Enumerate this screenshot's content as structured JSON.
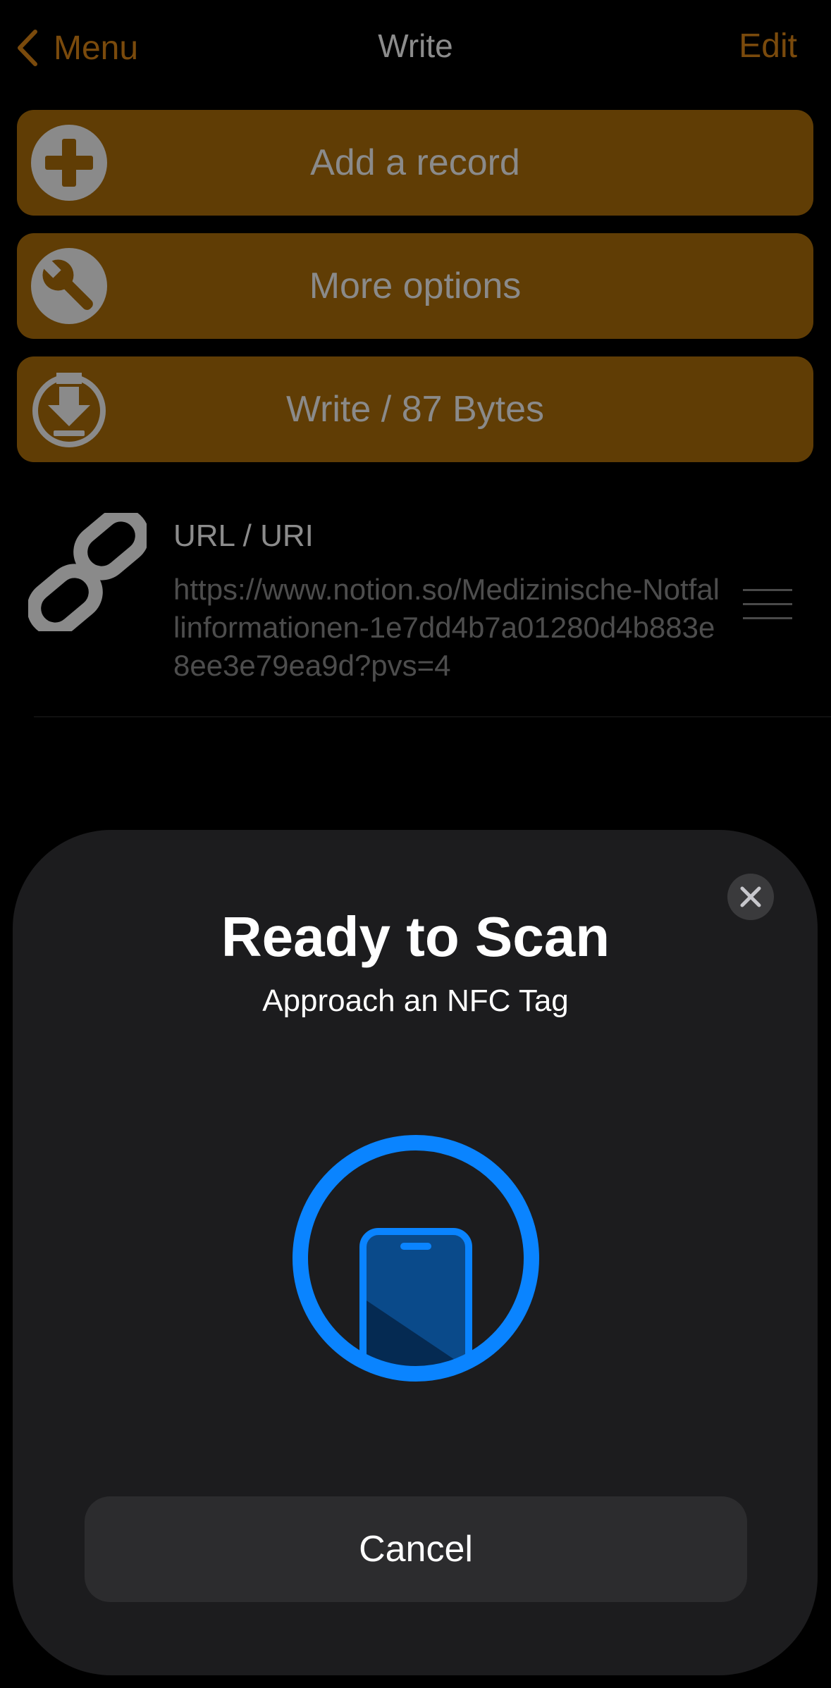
{
  "navbar": {
    "back_label": "Menu",
    "title": "Write",
    "edit_label": "Edit"
  },
  "actions": [
    {
      "label": "Add a record",
      "icon": "plus-circle-icon"
    },
    {
      "label": "More options",
      "icon": "wrench-icon"
    },
    {
      "label": "Write / 87 Bytes",
      "icon": "download-circle-icon"
    }
  ],
  "record": {
    "type": "URL / URI",
    "value": "https://www.notion.so/Medizinische-Notfallinformationen-1e7dd4b7a01280d4b883e8ee3e79ea9d?pvs=4",
    "icon": "link-icon"
  },
  "sheet": {
    "title": "Ready to Scan",
    "subtitle": "Approach an NFC Tag",
    "cancel_label": "Cancel",
    "accent_color": "#0a84ff"
  },
  "colors": {
    "button_bg": "#603d05",
    "nav_accent": "#7a4a0c",
    "sheet_bg": "#1c1c1e"
  }
}
